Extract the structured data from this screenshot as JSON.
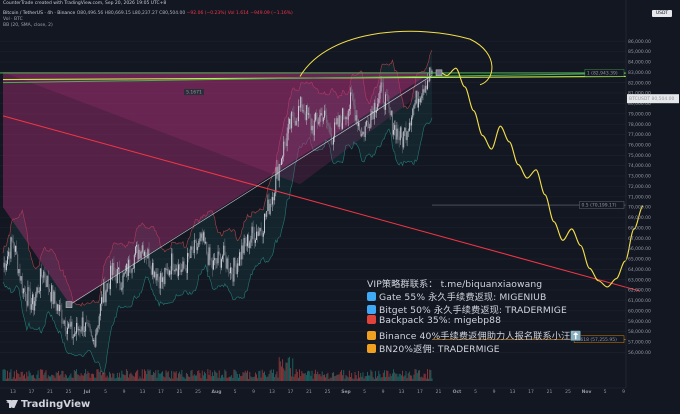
{
  "header": {
    "created_line": "CounterTrade created with TradingView.com, Sep 20, 2026 19:05 UTC+8",
    "symbol": "Bitcoin / TetherUS · 4h · Binance",
    "ohlc": "O80,496.56 H80,669.15 L80,237.27 C80,504.00",
    "change": "−92.06 (−0.23%)  Vol 1.614  −949.09 (−1.16%)",
    "vol_label": "Vol · BTC",
    "indicator_label": "BB (20, SMA, close, 2)"
  },
  "currency_badge": "USDT",
  "brand": "TradingView",
  "ads": [
    {
      "icon": "",
      "text": "VIP策略群联系： t.me/biquanxiaowang"
    },
    {
      "icon": "#3fa9f5",
      "text": "Gate 55% 永久手续费返现: MIGENIUB"
    },
    {
      "icon": "#3fa9f5",
      "text": "Bitget 50% 永久手续费返现: TRADERMIGE"
    },
    {
      "icon": "#e0433a",
      "text": "Backpack 35%: migebp88"
    },
    {
      "icon": "#f0a020",
      "text": "Binance 40%手续费返佣助力人报名联系小汪⬆️"
    },
    {
      "icon": "#f0a020",
      "text": "BN20%返佣:  TRADERMIGE"
    }
  ],
  "chart_data": {
    "type": "line",
    "title": "",
    "xlabel": "",
    "ylabel": "",
    "y_ticks": [
      86000,
      85000,
      84000,
      83000,
      82000,
      81000,
      80000,
      79000,
      78000,
      77000,
      76000,
      75000,
      74000,
      73000,
      72000,
      71000,
      70000,
      69000,
      68000,
      67000,
      66000,
      65000,
      64000,
      63000,
      62000,
      61000,
      60000,
      59000,
      58000,
      57000,
      56000
    ],
    "ylim": [
      55800,
      87600
    ],
    "x_tick_labels": [
      "13",
      "17",
      "21",
      "25",
      "Jul",
      "5",
      "9",
      "13",
      "17",
      "21",
      "25",
      "Aug",
      "5",
      "9",
      "13",
      "17",
      "21",
      "25",
      "Sep",
      "5",
      "9",
      "13",
      "17",
      "21",
      "Oct",
      "5",
      "9",
      "13",
      "17",
      "21",
      "25",
      "Nov",
      "5",
      "9"
    ],
    "price_tags": [
      {
        "text": "BTCUSDT  80,504.00",
        "value": 80504,
        "color": "#e6e7ea"
      },
      {
        "text": "1 (82,943.39)",
        "value": 82943,
        "color": "#4caf50"
      },
      {
        "text": "0.5 (70,199.17)",
        "value": 70199,
        "color": "#787b86"
      },
      {
        "text": "0.618 (57,255.95)",
        "value": 57256,
        "color": "#ff9800"
      }
    ],
    "annotations": [
      {
        "text": "5.1671"
      }
    ],
    "series": [
      {
        "values": [
          64200,
          66800,
          62100,
          60500,
          63900,
          61200,
          59400,
          57600,
          58900,
          56700,
          61400,
          63800,
          62900,
          65100,
          66400,
          64300,
          62700,
          64900,
          63800,
          65600,
          66700,
          64200,
          65400,
          63800,
          65900,
          67300,
          68200,
          71200,
          75400,
          78400,
          79800,
          77600,
          79100,
          76800,
          78600,
          80300,
          76900,
          79400,
          81200,
          78100,
          76400,
          79300,
          81600,
          83100
        ]
      },
      {
        "values": [
          83100,
          82700,
          83400,
          81600,
          79300,
          76900,
          75600,
          77800,
          76300,
          74100,
          72800,
          73600,
          71200,
          68600,
          66800,
          67900,
          66300,
          64100,
          62900,
          62300,
          63100,
          64800,
          67900,
          70100
        ]
      }
    ],
    "fib_levels": [
      {
        "level": "1",
        "price": 82943.39
      },
      {
        "level": "0.5",
        "price": 70199.17
      },
      {
        "level": "0.618",
        "price": 57255.95
      }
    ]
  }
}
